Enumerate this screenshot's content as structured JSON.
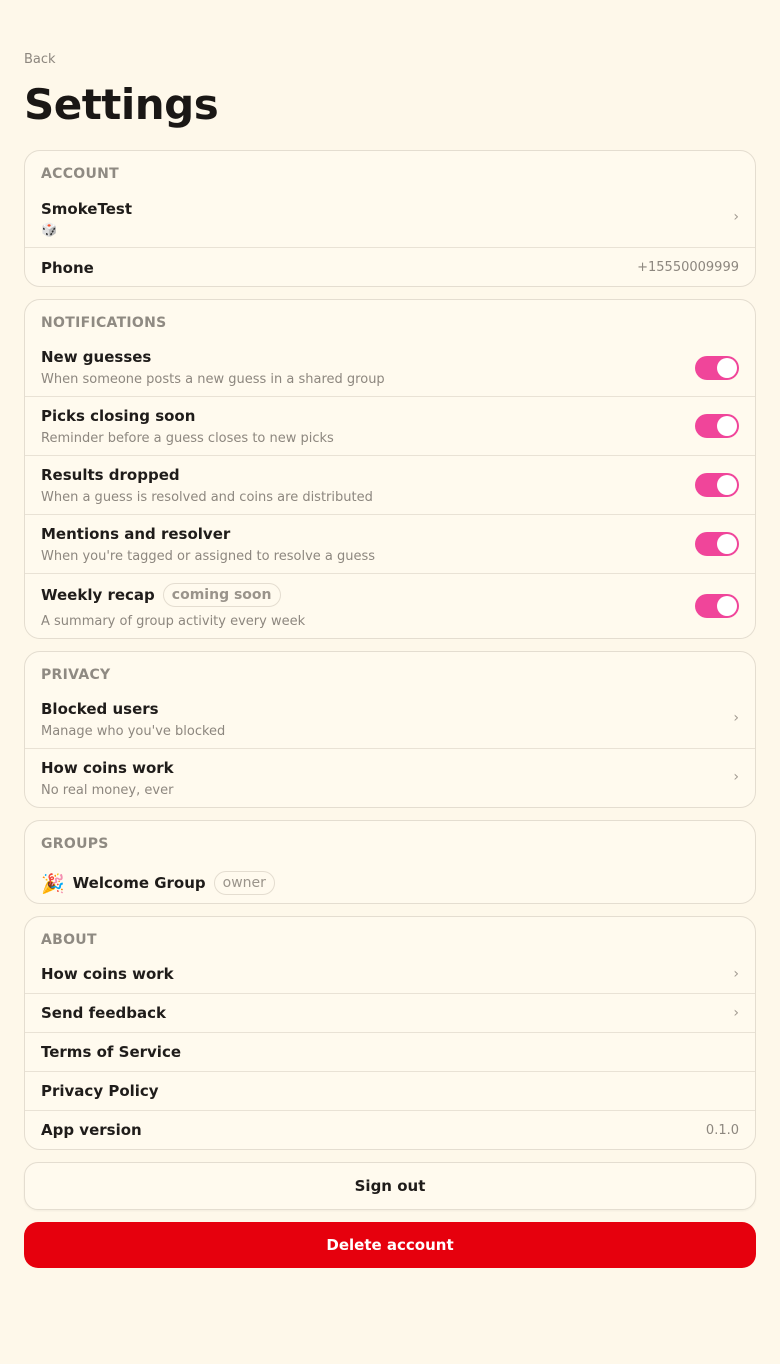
{
  "nav": {
    "back_label": "Back"
  },
  "page_title": "Settings",
  "account": {
    "section_title": "ACCOUNT",
    "username": "SmokeTest",
    "avatar_emoji": "🎲",
    "phone_label": "Phone",
    "phone_value": "+15550009999"
  },
  "notifications": {
    "section_title": "NOTIFICATIONS",
    "items": [
      {
        "label": "New guesses",
        "description": "When someone posts a new guess in a shared group",
        "enabled": true
      },
      {
        "label": "Picks closing soon",
        "description": "Reminder before a guess closes to new picks",
        "enabled": true
      },
      {
        "label": "Results dropped",
        "description": "When a guess is resolved and coins are distributed",
        "enabled": true
      },
      {
        "label": "Mentions and resolver",
        "description": "When you're tagged or assigned to resolve a guess",
        "enabled": true
      },
      {
        "label": "Weekly recap",
        "badge": "coming soon",
        "description": "A summary of group activity every week",
        "enabled": true
      }
    ]
  },
  "privacy": {
    "section_title": "PRIVACY",
    "items": [
      {
        "label": "Blocked users",
        "description": "Manage who you've blocked"
      },
      {
        "label": "How coins work",
        "description": "No real money, ever"
      }
    ]
  },
  "groups": {
    "section_title": "GROUPS",
    "items": [
      {
        "emoji": "🎉",
        "name": "Welcome Group",
        "role": "owner"
      }
    ]
  },
  "about": {
    "section_title": "ABOUT",
    "items": [
      {
        "label": "How coins work"
      },
      {
        "label": "Send feedback"
      },
      {
        "label": "Terms of Service"
      },
      {
        "label": "Privacy Policy"
      },
      {
        "label": "App version",
        "value": "0.1.0"
      }
    ]
  },
  "actions": {
    "sign_out_label": "Sign out",
    "delete_account_label": "Delete account"
  },
  "colors": {
    "background": "#fef8ea",
    "toggle_on": "#f0459a",
    "danger": "#e6000d"
  }
}
